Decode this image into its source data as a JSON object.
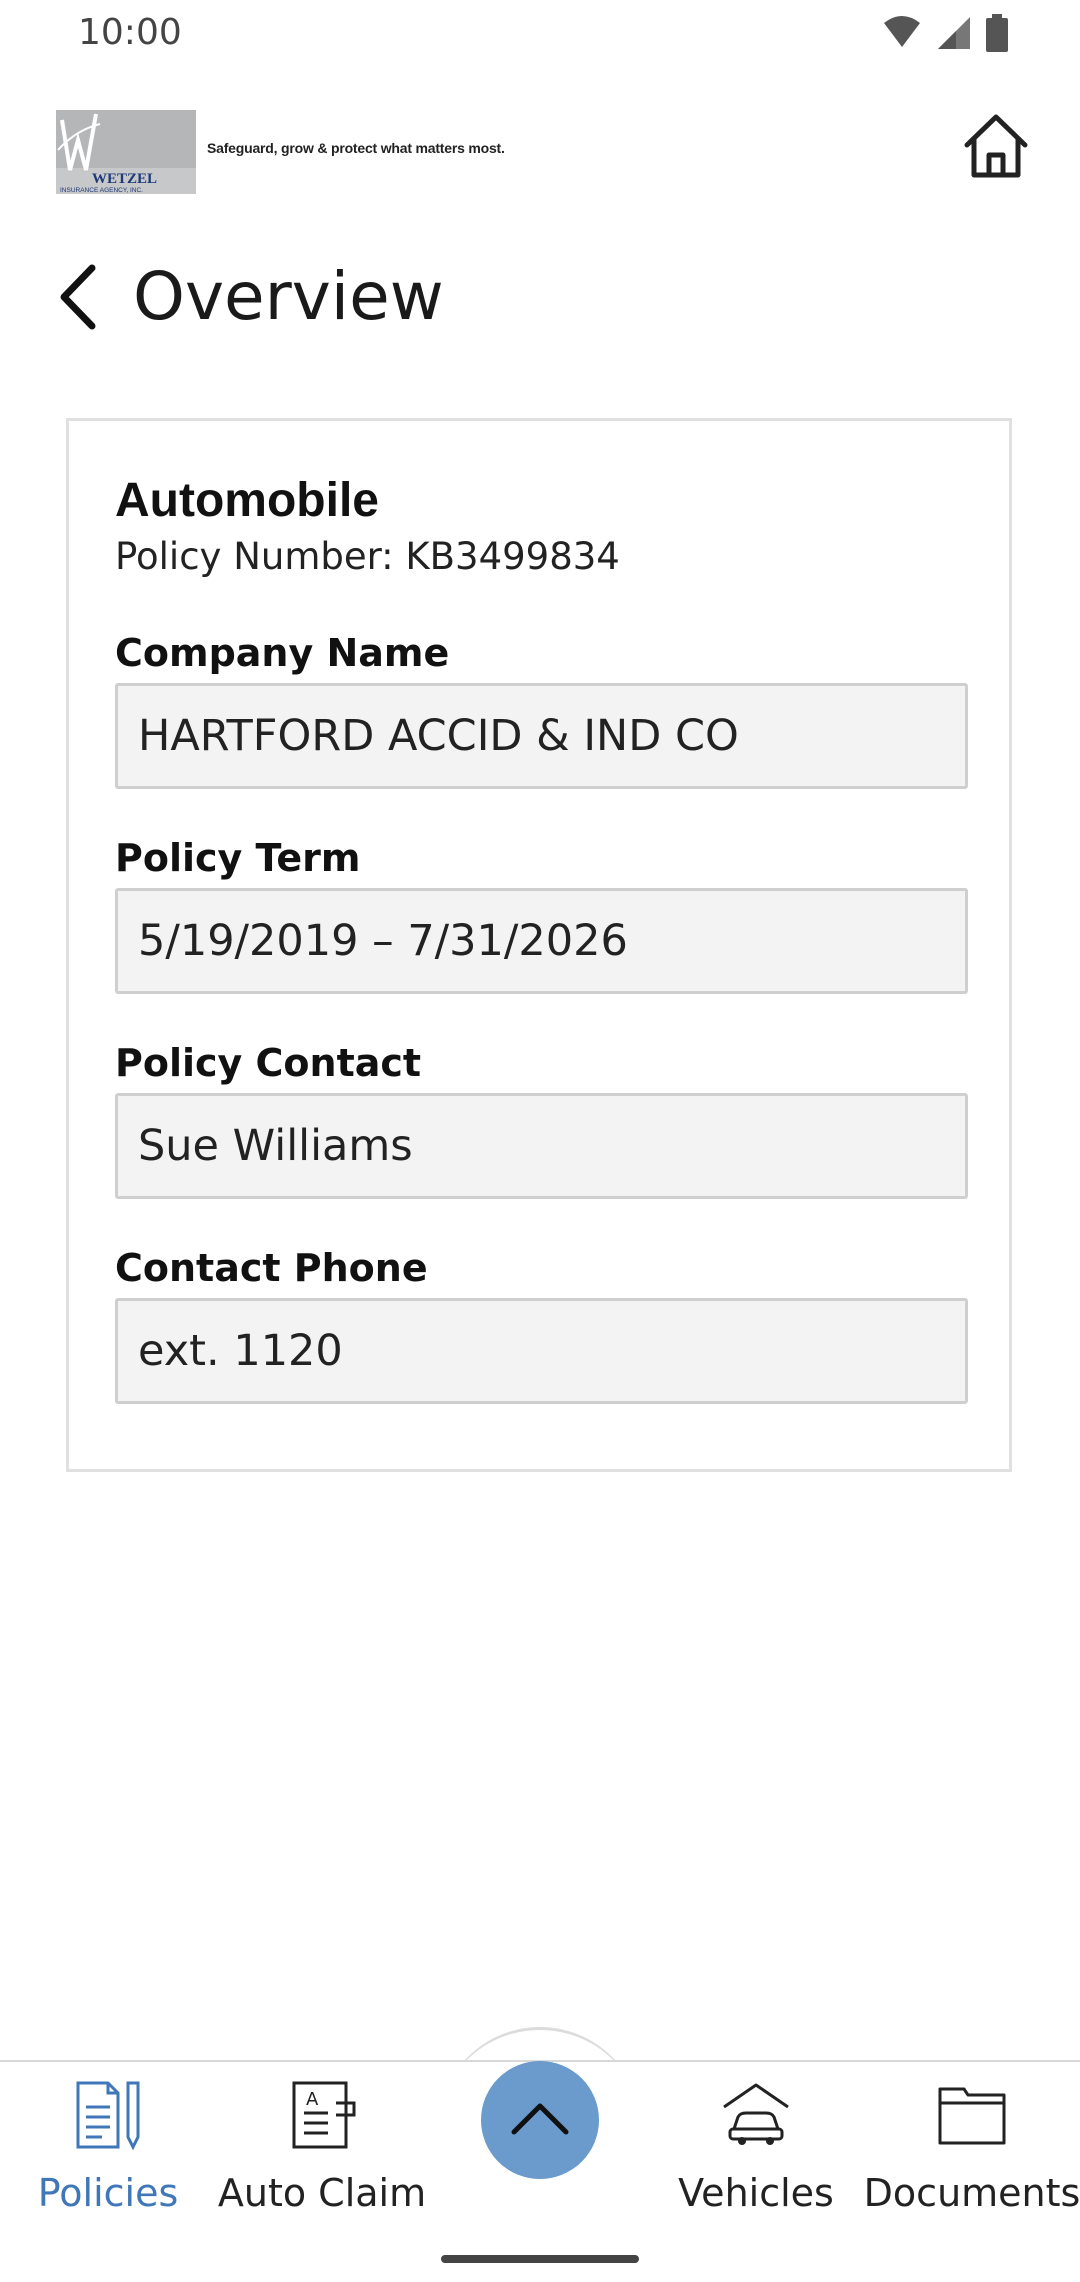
{
  "status_bar": {
    "time": "10:00",
    "icons": [
      "wifi-icon",
      "signal-icon",
      "battery-icon"
    ]
  },
  "header": {
    "logo_text": "WETZEL",
    "logo_subtext": "INSURANCE AGENCY, INC.",
    "tagline": "Safeguard, grow & protect what matters most.",
    "home_icon": "home-icon"
  },
  "page": {
    "title": "Overview",
    "back_icon": "chevron-left-icon"
  },
  "policy": {
    "type": "Automobile",
    "number_label": "Policy Number:",
    "number_value": "KB3499834",
    "fields": [
      {
        "label": "Company Name",
        "value": "HARTFORD ACCID & IND CO"
      },
      {
        "label": "Policy Term",
        "value": "5/19/2019 – 7/31/2026"
      },
      {
        "label": "Policy Contact",
        "value": "Sue Williams"
      },
      {
        "label": "Contact Phone",
        "value": "ext. 1120"
      }
    ]
  },
  "bottom_nav": {
    "items": [
      {
        "label": "Policies",
        "icon": "policy-document-icon",
        "active": true
      },
      {
        "label": "Auto Claim",
        "icon": "claim-form-icon",
        "active": false
      },
      {
        "label": "Vehicles",
        "icon": "car-garage-icon",
        "active": false
      },
      {
        "label": "Documents",
        "icon": "folder-icon",
        "active": false
      }
    ],
    "fab_icon": "chevron-up-icon"
  },
  "colors": {
    "accent": "#3f77b8",
    "fab": "#6a9bcc",
    "field_bg": "#f3f3f4"
  }
}
